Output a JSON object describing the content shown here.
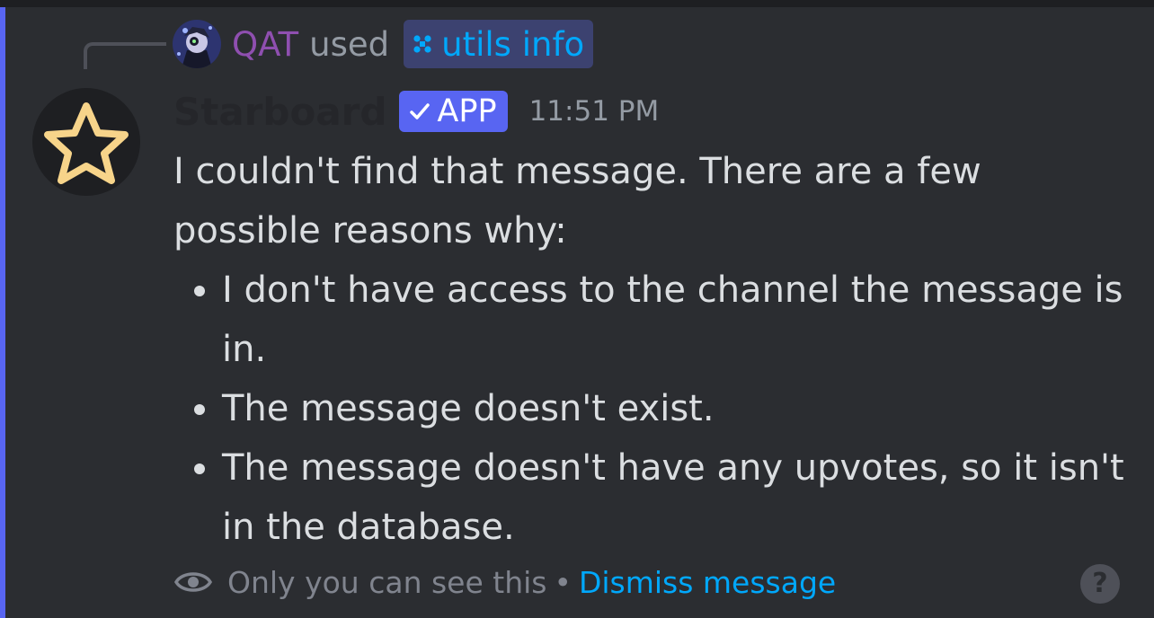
{
  "reference": {
    "username": "QAT",
    "used_text": "used",
    "command": "utils info",
    "avatar_icon": "user-avatar-icon",
    "command_icon": "slash-command-icon"
  },
  "message": {
    "author": "Starboard",
    "badge": "APP",
    "timestamp": "11:51 PM",
    "avatar_icon": "star-icon",
    "intro": "I couldn't find that message. There are a few possible reasons why:",
    "reasons": [
      "I don't have access to the channel the message is in.",
      "The message doesn't exist.",
      "The message doesn't have any upvotes, so it isn't in the database."
    ]
  },
  "footer": {
    "visibility_text": "Only you can see this",
    "separator": "•",
    "dismiss_label": "Dismiss message",
    "help_label": "?"
  },
  "colors": {
    "background": "#2b2d31",
    "accent": "#5865f2",
    "username": "#8f4fb0",
    "link": "#00a8fc",
    "star": "#f7d48a"
  }
}
